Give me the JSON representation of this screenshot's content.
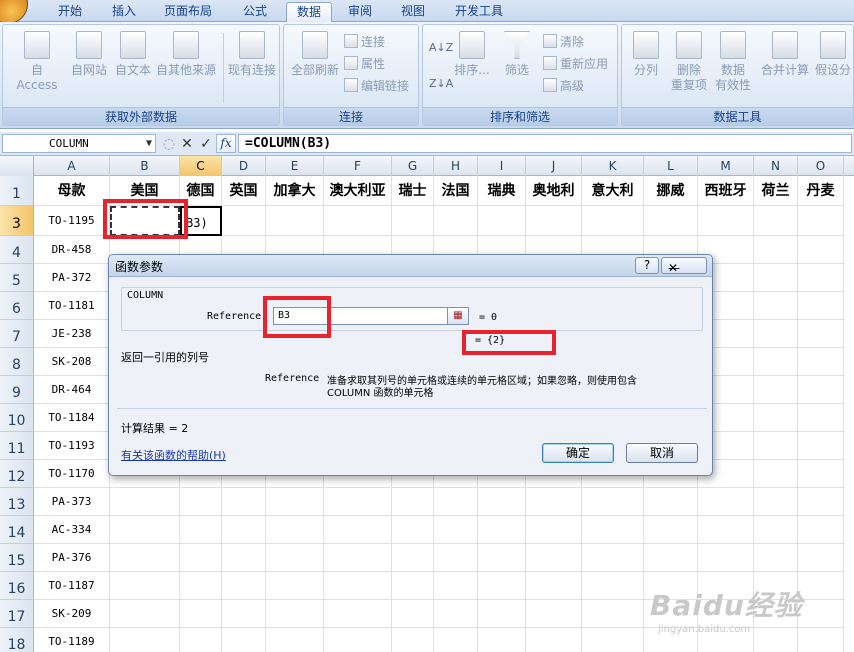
{
  "ribbon": {
    "tabs": [
      {
        "label": "开始",
        "active": false
      },
      {
        "label": "插入",
        "active": false
      },
      {
        "label": "页面布局",
        "active": false
      },
      {
        "label": "公式",
        "active": false
      },
      {
        "label": "数据",
        "active": true
      },
      {
        "label": "审阅",
        "active": false
      },
      {
        "label": "视图",
        "active": false
      },
      {
        "label": "开发工具",
        "active": false
      }
    ],
    "groups": {
      "external": {
        "label": "获取外部数据",
        "buttons": [
          "自 Access",
          "自网站",
          "自文本",
          "自其他来源",
          "现有连接"
        ]
      },
      "connections": {
        "label": "连接",
        "refresh_all": "全部刷新",
        "connections": "连接",
        "properties": "属性",
        "edit_links": "编辑链接"
      },
      "sort_filter": {
        "label": "排序和筛选",
        "sort": "排序...",
        "filter": "筛选",
        "clear": "清除",
        "reapply": "重新应用",
        "advanced": "高级"
      },
      "data_tools": {
        "label": "数据工具",
        "text_to_columns": "分列",
        "remove_duplicates_1": "删除",
        "remove_duplicates_2": "重复项",
        "validation_1": "数据",
        "validation_2": "有效性",
        "consolidate": "合并计算",
        "what_if": "假设分"
      }
    }
  },
  "formula_bar": {
    "name_box": "COLUMN",
    "cancel_glyph": "✕",
    "enter_glyph": "✓",
    "fx": "fx",
    "formula": "=COLUMN(B3)"
  },
  "sheet": {
    "columns": [
      "A",
      "B",
      "C",
      "D",
      "E",
      "F",
      "G",
      "H",
      "I",
      "J",
      "K",
      "L",
      "M",
      "N",
      "O"
    ],
    "header_row": [
      "母款",
      "美国",
      "德国",
      "英国",
      "加拿大",
      "澳大利亚",
      "瑞士",
      "法国",
      "瑞典",
      "奥地利",
      "意大利",
      "挪威",
      "西班牙",
      "荷兰",
      "丹麦"
    ],
    "rows": [
      {
        "num": "1",
        "code": ""
      },
      {
        "num": "3",
        "code": "TO-1195"
      },
      {
        "num": "4",
        "code": "DR-458"
      },
      {
        "num": "5",
        "code": "PA-372"
      },
      {
        "num": "6",
        "code": "TO-1181"
      },
      {
        "num": "7",
        "code": "JE-238"
      },
      {
        "num": "8",
        "code": "SK-208"
      },
      {
        "num": "9",
        "code": "DR-464"
      },
      {
        "num": "10",
        "code": "TO-1184"
      },
      {
        "num": "11",
        "code": "TO-1193"
      },
      {
        "num": "12",
        "code": "TO-1170"
      },
      {
        "num": "13",
        "code": "PA-373"
      },
      {
        "num": "14",
        "code": "AC-334"
      },
      {
        "num": "15",
        "code": "PA-376"
      },
      {
        "num": "16",
        "code": "TO-1187"
      },
      {
        "num": "17",
        "code": "SK-209"
      },
      {
        "num": "18",
        "code": "TO-1189"
      }
    ],
    "c3_overflow": "B3)"
  },
  "dialog": {
    "title": "函数参数",
    "help_btn": "?",
    "min_btn": "—",
    "close_btn": "✕",
    "function_name": "COLUMN",
    "ref_label": "Reference",
    "ref_value": "B3",
    "ref_result": "= 0",
    "fn_result": "= {2}",
    "description": "返回一引用的列号",
    "arg_name": "Reference",
    "arg_desc_1": "准备求取其列号的单元格或连续的单元格区域；如果忽略，则使用包含",
    "arg_desc_2": "COLUMN 函数的单元格",
    "calc_result": "计算结果 = 2",
    "help_link": "有关该函数的帮助(H)",
    "ok": "确定",
    "cancel": "取消"
  },
  "watermark": {
    "logo": "Baidu经验",
    "url": "jingyan.baidu.com"
  },
  "colors": {
    "highlight": "#e8232e",
    "ribbon_text": "#15428b"
  }
}
